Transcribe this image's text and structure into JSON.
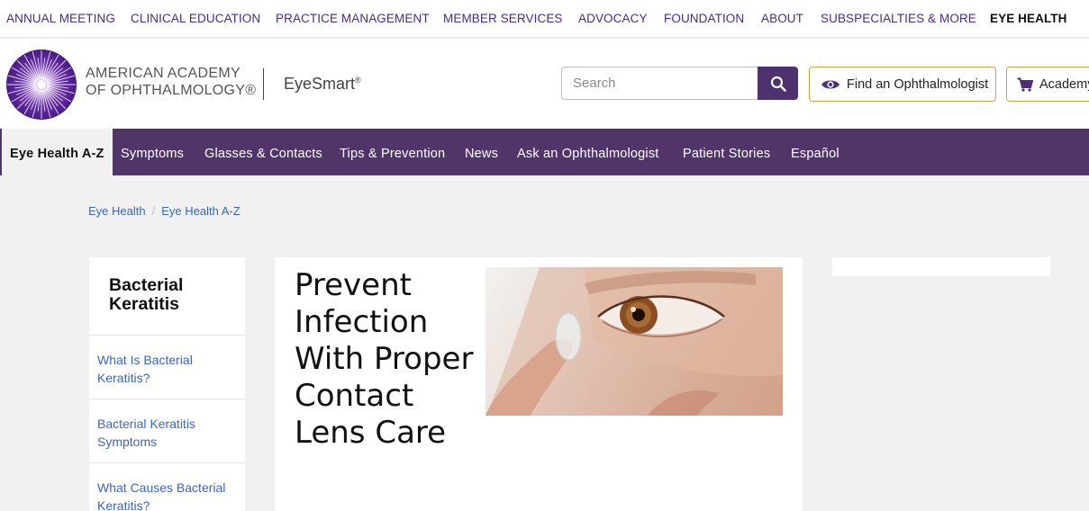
{
  "top_nav": {
    "items": [
      "ANNUAL MEETING",
      "CLINICAL EDUCATION",
      "PRACTICE MANAGEMENT",
      "MEMBER SERVICES",
      "ADVOCACY",
      "FOUNDATION",
      "ABOUT",
      "SUBSPECIALTIES & MORE",
      "EYE HEALTH"
    ],
    "active": "EYE HEALTH"
  },
  "header": {
    "org_line1": "AMERICAN ACADEMY",
    "org_line2": "OF OPHTHALMOLOGY®",
    "site_name": "EyeSmart",
    "site_mark": "®",
    "search_placeholder": "Search",
    "find_label": "Find an Ophthalmologist",
    "academy_label": "Academy Store"
  },
  "main_nav": {
    "items": [
      "Eye Health A-Z",
      "Symptoms",
      "Glasses & Contacts",
      "Tips & Prevention",
      "News",
      "Ask an Ophthalmologist",
      "Patient Stories",
      "Español"
    ],
    "active": "Eye Health A-Z"
  },
  "breadcrumb": [
    "Eye Health",
    "Eye Health A-Z"
  ],
  "sidebar": {
    "title": "Bacterial Keratitis",
    "items": [
      "What Is Bacterial Keratitis?",
      "Bacterial Keratitis Symptoms",
      "What Causes Bacterial Keratitis?"
    ]
  },
  "article": {
    "title": "Prevent Infection With Proper Contact Lens Care"
  },
  "colors": {
    "brand_purple": "#513468",
    "link_blue": "#3b66b5",
    "button_border": "#c9a545"
  },
  "icons": [
    "aao-logo-icon",
    "search-icon",
    "eye-icon",
    "cart-icon"
  ]
}
